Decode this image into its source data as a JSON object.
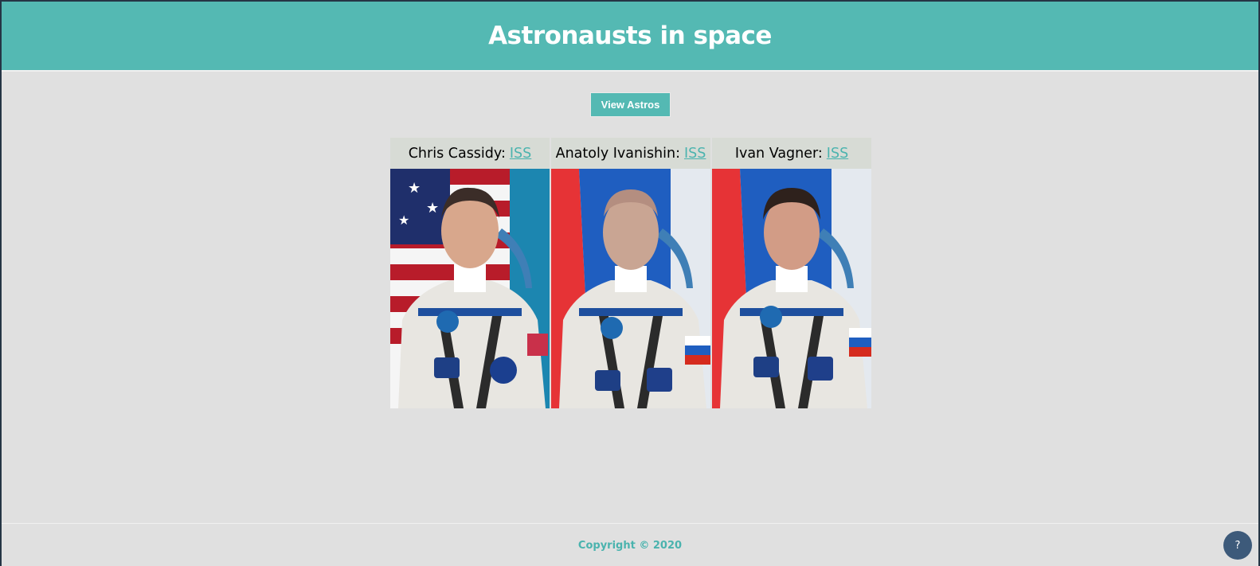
{
  "header": {
    "title": "Astronausts in space"
  },
  "actions": {
    "view_label": "View Astros"
  },
  "astronauts": [
    {
      "name": "Chris Cassidy:",
      "craft": "ISS",
      "flag": "usa"
    },
    {
      "name": "Anatoly Ivanishin:",
      "craft": "ISS",
      "flag": "russia"
    },
    {
      "name": "Ivan Vagner:",
      "craft": "ISS",
      "flag": "russia"
    }
  ],
  "footer": {
    "copyright": "Copyright © 2020"
  },
  "help": {
    "label": "?"
  },
  "colors": {
    "accent": "#54b9b3",
    "link": "#4ab3ae",
    "background": "#e0e0e0",
    "help": "#3d5a7a"
  }
}
